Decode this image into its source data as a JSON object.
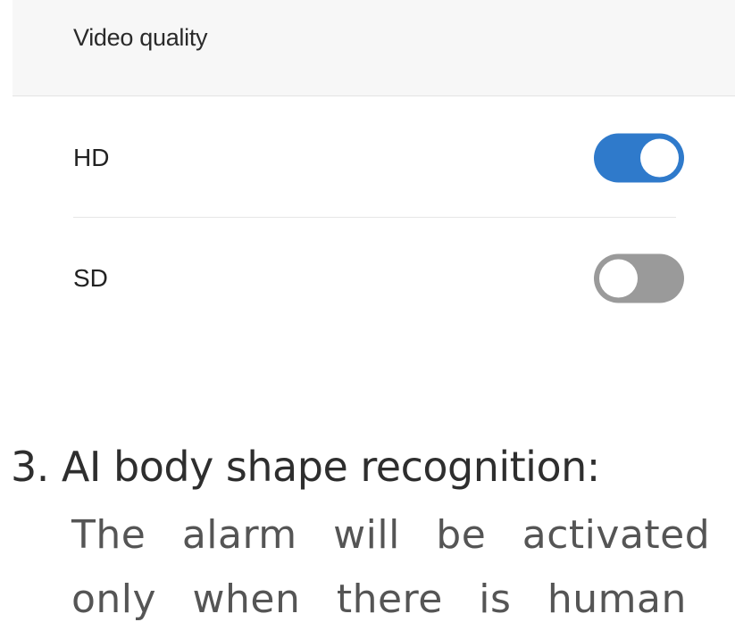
{
  "video_quality": {
    "title": "Video quality",
    "options": [
      {
        "label": "HD",
        "enabled": true
      },
      {
        "label": "SD",
        "enabled": false
      }
    ]
  },
  "instructions": {
    "heading_number": "3.",
    "heading_text": "AI body shape recognition:",
    "body_line_1": "The alarm will be activated",
    "body_line_2": "only when there is human"
  },
  "colors": {
    "toggle_on": "#2f7acb",
    "toggle_off": "#9a9a9a",
    "header_background": "#f7f7f7"
  }
}
